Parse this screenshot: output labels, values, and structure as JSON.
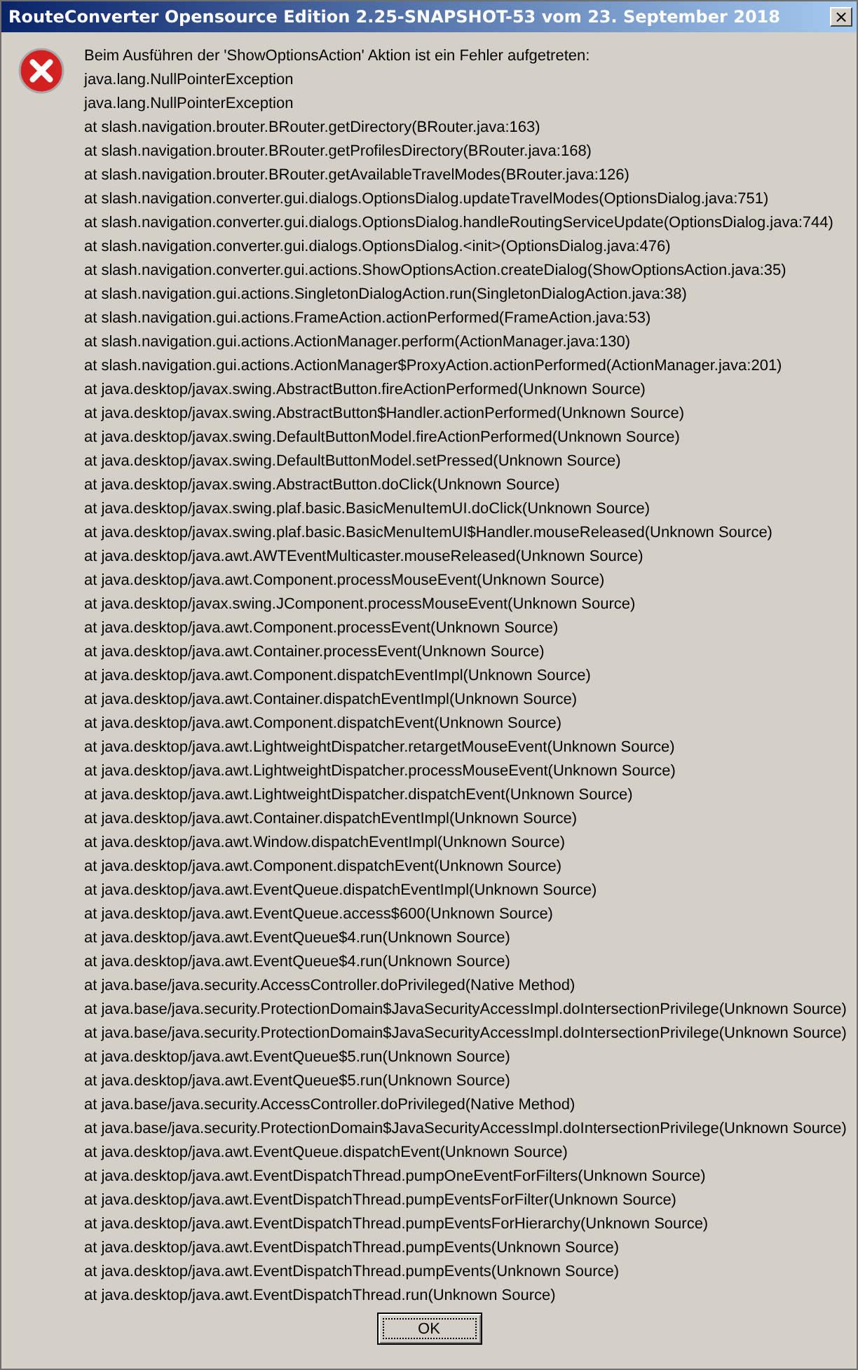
{
  "window": {
    "title": "RouteConverter Opensource Edition 2.25-SNAPSHOT-53 vom 23. September 2018",
    "close": "×"
  },
  "message": "Beim Ausführen der 'ShowOptionsAction' Aktion ist ein Fehler aufgetreten:",
  "lines": [
    "java.lang.NullPointerException",
    "java.lang.NullPointerException",
    "at slash.navigation.brouter.BRouter.getDirectory(BRouter.java:163)",
    "at slash.navigation.brouter.BRouter.getProfilesDirectory(BRouter.java:168)",
    "at slash.navigation.brouter.BRouter.getAvailableTravelModes(BRouter.java:126)",
    "at slash.navigation.converter.gui.dialogs.OptionsDialog.updateTravelModes(OptionsDialog.java:751)",
    "at slash.navigation.converter.gui.dialogs.OptionsDialog.handleRoutingServiceUpdate(OptionsDialog.java:744)",
    "at slash.navigation.converter.gui.dialogs.OptionsDialog.<init>(OptionsDialog.java:476)",
    "at slash.navigation.converter.gui.actions.ShowOptionsAction.createDialog(ShowOptionsAction.java:35)",
    "at slash.navigation.gui.actions.SingletonDialogAction.run(SingletonDialogAction.java:38)",
    "at slash.navigation.gui.actions.FrameAction.actionPerformed(FrameAction.java:53)",
    "at slash.navigation.gui.actions.ActionManager.perform(ActionManager.java:130)",
    "at slash.navigation.gui.actions.ActionManager$ProxyAction.actionPerformed(ActionManager.java:201)",
    "at java.desktop/javax.swing.AbstractButton.fireActionPerformed(Unknown Source)",
    "at java.desktop/javax.swing.AbstractButton$Handler.actionPerformed(Unknown Source)",
    "at java.desktop/javax.swing.DefaultButtonModel.fireActionPerformed(Unknown Source)",
    "at java.desktop/javax.swing.DefaultButtonModel.setPressed(Unknown Source)",
    "at java.desktop/javax.swing.AbstractButton.doClick(Unknown Source)",
    "at java.desktop/javax.swing.plaf.basic.BasicMenuItemUI.doClick(Unknown Source)",
    "at java.desktop/javax.swing.plaf.basic.BasicMenuItemUI$Handler.mouseReleased(Unknown Source)",
    "at java.desktop/java.awt.AWTEventMulticaster.mouseReleased(Unknown Source)",
    "at java.desktop/java.awt.Component.processMouseEvent(Unknown Source)",
    "at java.desktop/javax.swing.JComponent.processMouseEvent(Unknown Source)",
    "at java.desktop/java.awt.Component.processEvent(Unknown Source)",
    "at java.desktop/java.awt.Container.processEvent(Unknown Source)",
    "at java.desktop/java.awt.Component.dispatchEventImpl(Unknown Source)",
    "at java.desktop/java.awt.Container.dispatchEventImpl(Unknown Source)",
    "at java.desktop/java.awt.Component.dispatchEvent(Unknown Source)",
    "at java.desktop/java.awt.LightweightDispatcher.retargetMouseEvent(Unknown Source)",
    "at java.desktop/java.awt.LightweightDispatcher.processMouseEvent(Unknown Source)",
    "at java.desktop/java.awt.LightweightDispatcher.dispatchEvent(Unknown Source)",
    "at java.desktop/java.awt.Container.dispatchEventImpl(Unknown Source)",
    "at java.desktop/java.awt.Window.dispatchEventImpl(Unknown Source)",
    "at java.desktop/java.awt.Component.dispatchEvent(Unknown Source)",
    "at java.desktop/java.awt.EventQueue.dispatchEventImpl(Unknown Source)",
    "at java.desktop/java.awt.EventQueue.access$600(Unknown Source)",
    "at java.desktop/java.awt.EventQueue$4.run(Unknown Source)",
    "at java.desktop/java.awt.EventQueue$4.run(Unknown Source)",
    "at java.base/java.security.AccessController.doPrivileged(Native Method)",
    "at java.base/java.security.ProtectionDomain$JavaSecurityAccessImpl.doIntersectionPrivilege(Unknown Source)",
    "at java.base/java.security.ProtectionDomain$JavaSecurityAccessImpl.doIntersectionPrivilege(Unknown Source)",
    "at java.desktop/java.awt.EventQueue$5.run(Unknown Source)",
    "at java.desktop/java.awt.EventQueue$5.run(Unknown Source)",
    "at java.base/java.security.AccessController.doPrivileged(Native Method)",
    "at java.base/java.security.ProtectionDomain$JavaSecurityAccessImpl.doIntersectionPrivilege(Unknown Source)",
    "at java.desktop/java.awt.EventQueue.dispatchEvent(Unknown Source)",
    "at java.desktop/java.awt.EventDispatchThread.pumpOneEventForFilters(Unknown Source)",
    "at java.desktop/java.awt.EventDispatchThread.pumpEventsForFilter(Unknown Source)",
    "at java.desktop/java.awt.EventDispatchThread.pumpEventsForHierarchy(Unknown Source)",
    "at java.desktop/java.awt.EventDispatchThread.pumpEvents(Unknown Source)",
    "at java.desktop/java.awt.EventDispatchThread.pumpEvents(Unknown Source)",
    "at java.desktop/java.awt.EventDispatchThread.run(Unknown Source)"
  ],
  "buttons": [
    "OK"
  ]
}
